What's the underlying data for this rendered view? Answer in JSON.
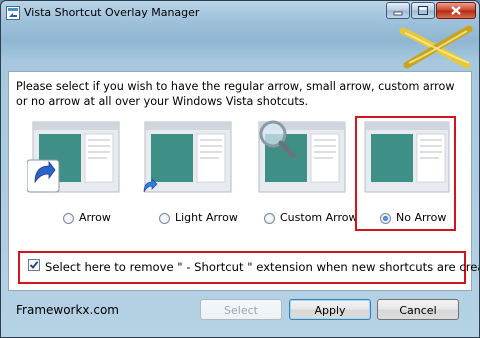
{
  "window": {
    "title": "Vista Shortcut Overlay Manager"
  },
  "instructions": "Please select if you wish to have the regular arrow, small arrow, custom arrow or no arrow at all over your Windows Vista shotcuts.",
  "options": [
    {
      "label": "Arrow",
      "selected": false,
      "preview_icon": "large-shortcut-arrow"
    },
    {
      "label": "Light Arrow",
      "selected": false,
      "preview_icon": "small-shortcut-arrow"
    },
    {
      "label": "Custom Arrow",
      "selected": false,
      "preview_icon": "magnifier"
    },
    {
      "label": "No Arrow",
      "selected": true,
      "preview_icon": "none"
    }
  ],
  "remove_extension": {
    "label": "Select here to remove \" - Shortcut \" extension when new shortcuts are created.",
    "checked": true
  },
  "footer": {
    "brand": "Frameworkx.com"
  },
  "buttons": {
    "select": "Select",
    "apply": "Apply",
    "cancel": "Cancel"
  },
  "colors": {
    "highlight_border": "#d1151e",
    "title_bar": "#9fc2dc",
    "close_button": "#c8412a"
  }
}
